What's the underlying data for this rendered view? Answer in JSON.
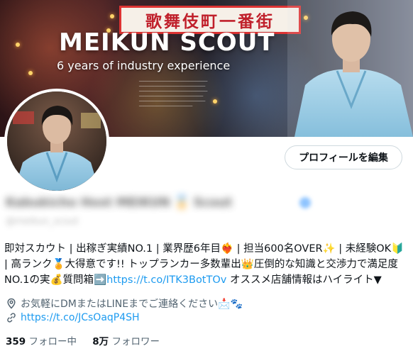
{
  "banner": {
    "sign_text": "歌舞伎町一番街",
    "title": "MEIKUN SCOUT",
    "subtitle": "6 years of industry experience"
  },
  "profile": {
    "edit_button_label": "プロフィールを編集",
    "display_name": "Kabukicho Host MEIKUN 🏅 Scout",
    "handle": "@meikun_scout"
  },
  "bio": {
    "line1": "即対スカウト | 出稼ぎ実績NO.1 | 業界歴6年目❤️‍🔥 | 担当600名OVER✨ | 未経験OK🔰",
    "line2": "| 高ランク🏅大得意です!! トップランカー多数輩出👑圧倒的な知識と交渉力で満足度",
    "line3_prefix": "NO.1の実💰質問箱➡️",
    "line3_link": "https://t.co/ITK3BotTOv",
    "line3_suffix": " オススメ店舗情報はハイライト▼"
  },
  "meta": {
    "location_icon": "location-pin-icon",
    "location": "お気軽にDMまたはLINEまでご連絡ください📩🐾",
    "link_icon": "link-icon",
    "link": "https://t.co/JCsOaqP4SH"
  },
  "stats": {
    "following_count": "359",
    "following_label": "フォロー中",
    "followers_count": "8万",
    "followers_label": "フォロワー"
  },
  "colors": {
    "accent": "#1d9bf0",
    "muted_text": "#536471",
    "sign_red": "#c0202b",
    "kimono_blue": "#9ecfe8"
  }
}
